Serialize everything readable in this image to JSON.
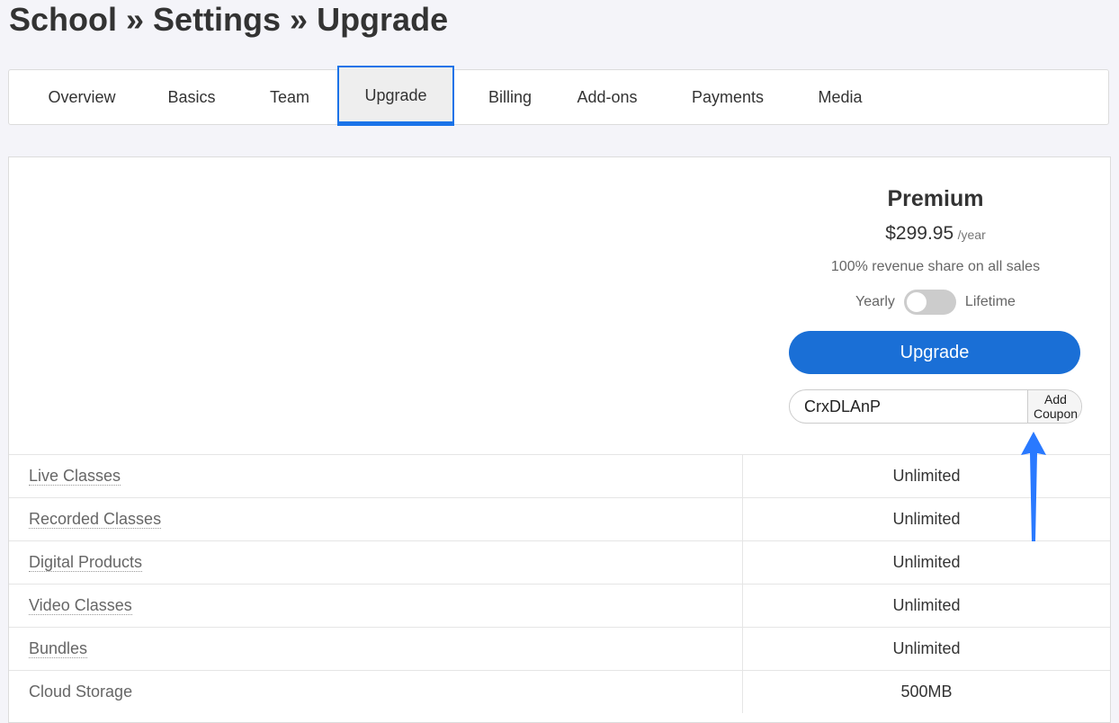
{
  "page": {
    "title": "School » Settings » Upgrade"
  },
  "tabs": [
    {
      "label": "Overview"
    },
    {
      "label": "Basics"
    },
    {
      "label": "Team"
    },
    {
      "label": "Upgrade",
      "active": true
    },
    {
      "label": "Billing"
    },
    {
      "label": "Add-ons"
    },
    {
      "label": "Payments"
    },
    {
      "label": "Media"
    }
  ],
  "plan": {
    "name": "Premium",
    "price": "$299.95",
    "period": "/year",
    "description": "100% revenue share on all sales",
    "toggle_left": "Yearly",
    "toggle_right": "Lifetime",
    "upgrade_label": "Upgrade",
    "coupon_value": "CrxDLAnP",
    "coupon_button": "Add Coupon"
  },
  "features": [
    {
      "name": "Live Classes",
      "value": "Unlimited"
    },
    {
      "name": "Recorded Classes",
      "value": "Unlimited"
    },
    {
      "name": "Digital Products",
      "value": "Unlimited"
    },
    {
      "name": "Video Classes",
      "value": "Unlimited"
    },
    {
      "name": "Bundles",
      "value": "Unlimited"
    },
    {
      "name": "Cloud Storage",
      "value": "500MB"
    }
  ],
  "colors": {
    "accent": "#1a6fd6",
    "arrow": "#2979ff"
  }
}
